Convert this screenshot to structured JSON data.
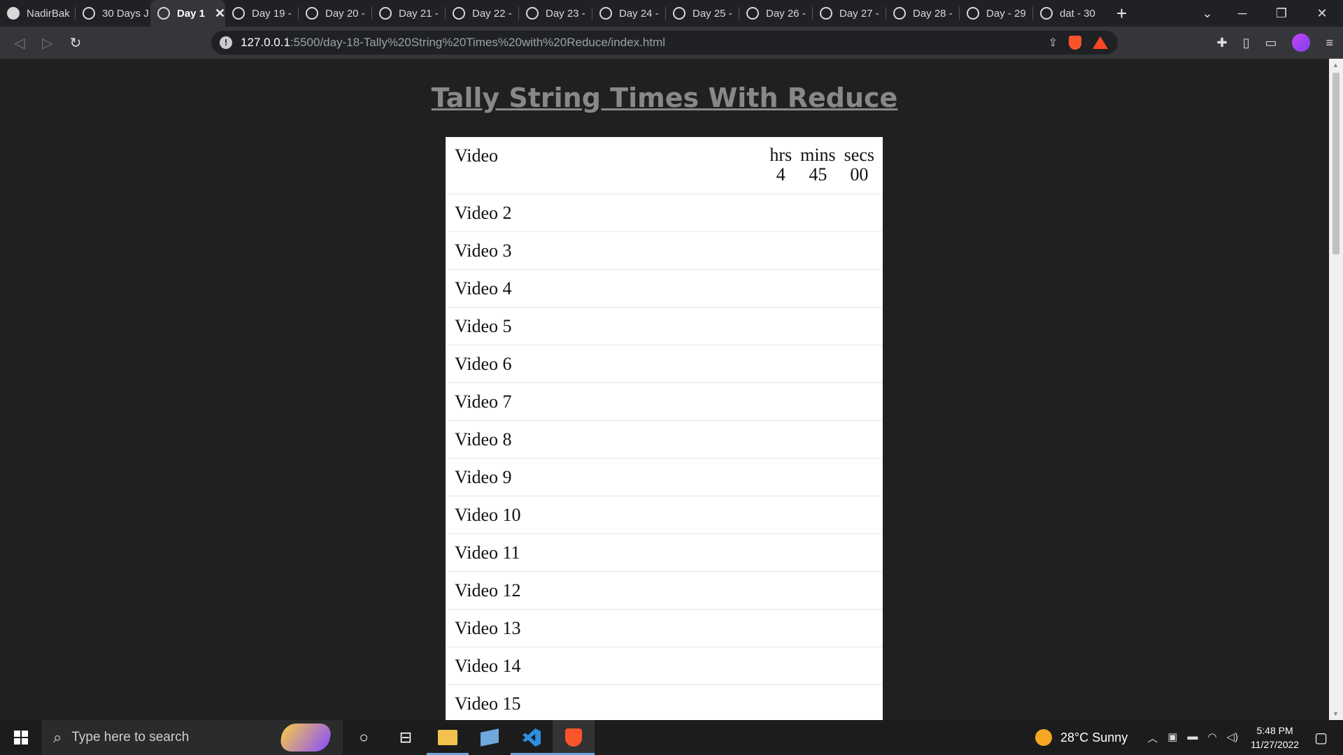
{
  "browser": {
    "tabs": [
      {
        "label": "NadirBak",
        "icon": "github-icon"
      },
      {
        "label": "30 Days J",
        "icon": "globe-icon"
      },
      {
        "label": "Day 1",
        "icon": "globe-icon",
        "active": true
      },
      {
        "label": "Day 19 -",
        "icon": "globe-icon"
      },
      {
        "label": "Day 20 -",
        "icon": "globe-icon"
      },
      {
        "label": "Day 21 -",
        "icon": "globe-icon"
      },
      {
        "label": "Day 22 -",
        "icon": "globe-icon"
      },
      {
        "label": "Day 23 -",
        "icon": "globe-icon"
      },
      {
        "label": "Day 24 -",
        "icon": "globe-icon"
      },
      {
        "label": "Day 25 -",
        "icon": "globe-icon"
      },
      {
        "label": "Day 26 -",
        "icon": "globe-icon"
      },
      {
        "label": "Day 27 -",
        "icon": "globe-icon"
      },
      {
        "label": "Day 28 -",
        "icon": "globe-icon"
      },
      {
        "label": "Day - 29",
        "icon": "globe-icon"
      },
      {
        "label": "dat - 30",
        "icon": "globe-icon"
      }
    ],
    "new_tab": "+",
    "url_host": "127.0.0.1",
    "url_path": ":5500/day-18-Tally%20String%20Times%20with%20Reduce/index.html"
  },
  "page": {
    "title": "Tally String Times With Reduce",
    "header_label": "Video",
    "time_headers": {
      "hrs": "hrs",
      "mins": "mins",
      "secs": "secs"
    },
    "time_values": {
      "hrs": "4",
      "mins": "45",
      "secs": "00"
    },
    "videos": [
      "Video 2",
      "Video 3",
      "Video 4",
      "Video 5",
      "Video 6",
      "Video 7",
      "Video 8",
      "Video 9",
      "Video 10",
      "Video 11",
      "Video 12",
      "Video 13",
      "Video 14",
      "Video 15"
    ]
  },
  "taskbar": {
    "search_placeholder": "Type here to search",
    "weather": "28°C  Sunny",
    "time": "5:48 PM",
    "date": "11/27/2022"
  }
}
